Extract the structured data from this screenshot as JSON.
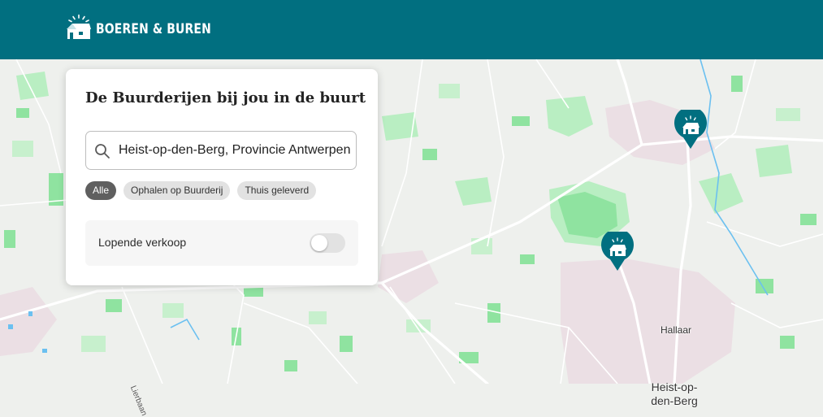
{
  "header": {
    "brand_name": "BOEREN & BUREN",
    "logo_icon": "farmhouse-logo-icon",
    "background_color": "#016f80"
  },
  "map": {
    "place_labels": {
      "hallaar": "Hallaar",
      "heist_line1": "Heist-op-",
      "heist_line2": "den-Berg"
    },
    "road_labels": {
      "lierbaan": "Lierbaan"
    },
    "markers": [
      {
        "icon": "farmhouse-pin-icon",
        "color": "#016f80"
      },
      {
        "icon": "farmhouse-pin-icon",
        "color": "#016f80"
      }
    ]
  },
  "panel": {
    "title": "De Buurderijen bij jou in de buurt",
    "search": {
      "icon": "search-icon",
      "value": "Heist-op-den-Berg, Provincie Antwerpen"
    },
    "filters": [
      {
        "label": "Alle",
        "active": true
      },
      {
        "label": "Ophalen op Buurderij",
        "active": false
      },
      {
        "label": "Thuis geleverd",
        "active": false
      }
    ],
    "toggle": {
      "label": "Lopende verkoop",
      "on": false
    }
  }
}
